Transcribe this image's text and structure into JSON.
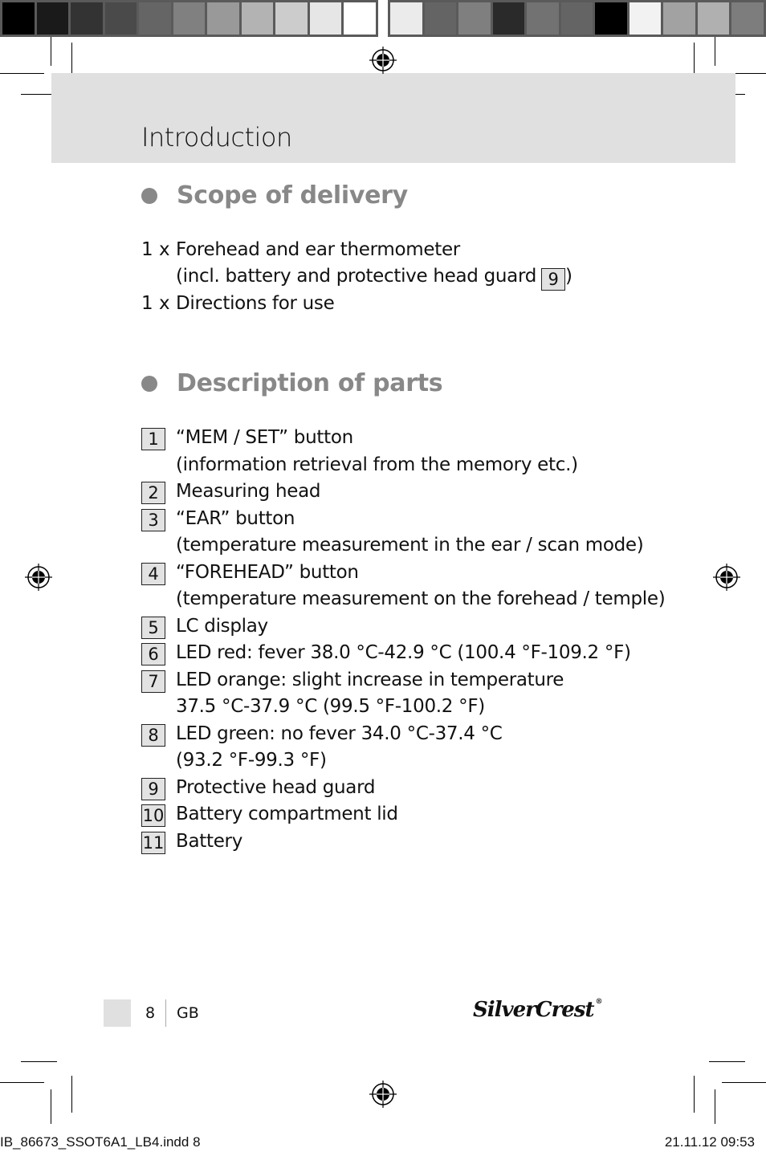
{
  "color_bars": {
    "left": [
      "#000000",
      "#1a1a1a",
      "#333333",
      "#4a4a4a",
      "#656565",
      "#808080",
      "#999999",
      "#b3b3b3",
      "#cccccc",
      "#e6e6e6",
      "#ffffff"
    ],
    "right": [
      "#ebebeb",
      "#646464",
      "#7f7f7f",
      "#2a2a2a",
      "#727272",
      "#646464",
      "#000000",
      "#f2f2f2",
      "#a2a2a2",
      "#b0b0b0",
      "#7d7d7d"
    ]
  },
  "header": {
    "title": "Introduction"
  },
  "scope_of_delivery": {
    "heading": "Scope of delivery",
    "items": [
      {
        "qty": "1 x",
        "lines": [
          "Forehead and ear thermometer",
          "(incl. battery and protective head guard"
        ],
        "ref": "9",
        "suffix": ")"
      },
      {
        "qty": "1 x",
        "lines": [
          "Directions for use"
        ]
      }
    ]
  },
  "description_of_parts": {
    "heading": "Description of parts",
    "items": [
      {
        "num": "1",
        "lines": [
          "“MEM / SET” button",
          "(information retrieval from the memory etc.)"
        ]
      },
      {
        "num": "2",
        "lines": [
          "Measuring head"
        ]
      },
      {
        "num": "3",
        "lines": [
          "“EAR” button",
          "(temperature measurement in the ear / scan mode)"
        ]
      },
      {
        "num": "4",
        "lines": [
          "“FOREHEAD” button",
          "(temperature measurement on the forehead / temple)"
        ]
      },
      {
        "num": "5",
        "lines": [
          "LC display"
        ]
      },
      {
        "num": "6",
        "lines": [
          "LED red: fever 38.0 °C-42.9 °C (100.4 °F-109.2 °F)"
        ]
      },
      {
        "num": "7",
        "lines": [
          "LED orange: slight increase in temperature",
          "37.5 °C-37.9 °C (99.5 °F-100.2 °F)"
        ]
      },
      {
        "num": "8",
        "lines": [
          "LED green: no fever 34.0 °C-37.4 °C",
          "(93.2 °F-99.3 °F)"
        ]
      },
      {
        "num": "9",
        "lines": [
          "Protective head guard"
        ]
      },
      {
        "num": "10",
        "lines": [
          "Battery compartment lid"
        ]
      },
      {
        "num": "11",
        "lines": [
          "Battery"
        ]
      }
    ]
  },
  "footer": {
    "page_number": "8",
    "language": "GB",
    "brand": "SilverCrest",
    "brand_mark": "®"
  },
  "slug": {
    "file": "IB_86673_SSOT6A1_LB4.indd   8",
    "date": "21.11.12   09:53"
  }
}
